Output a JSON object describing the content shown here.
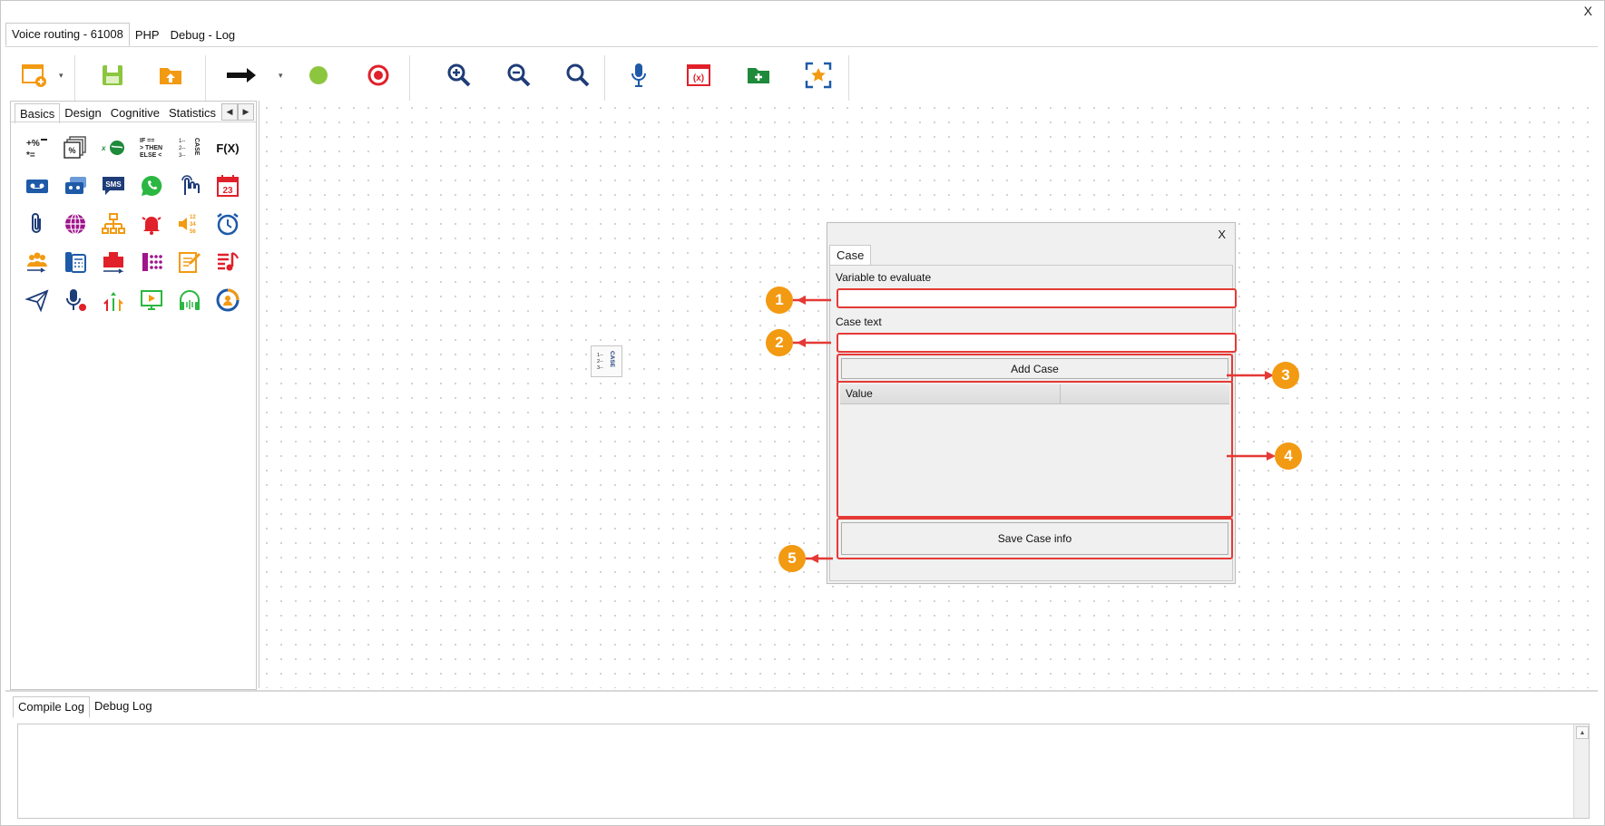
{
  "window": {
    "close_label": "X"
  },
  "top_tabs": [
    {
      "label": "Voice routing - 61008"
    },
    {
      "label": "PHP"
    },
    {
      "label": "Debug - Log"
    }
  ],
  "palette": {
    "tabs": [
      {
        "label": "Basics"
      },
      {
        "label": "Design"
      },
      {
        "label": "Cognitive"
      },
      {
        "label": "Statistics"
      }
    ]
  },
  "dialog": {
    "close_label": "X",
    "tab_label": "Case",
    "variable_label": "Variable to evaluate",
    "variable_value": "",
    "case_text_label": "Case text",
    "case_text_value": "",
    "add_case_label": "Add Case",
    "grid_columns": [
      "Value",
      ""
    ],
    "save_label": "Save Case info"
  },
  "callouts": [
    "1",
    "2",
    "3",
    "4",
    "5"
  ],
  "bottom_tabs": [
    {
      "label": "Compile Log"
    },
    {
      "label": "Debug Log"
    }
  ],
  "colors": {
    "accent_orange": "#f29a12",
    "highlight_red": "#e53935",
    "save_green": "#8cc63f",
    "stop_red": "#e0202a",
    "blue": "#1e5aa8"
  }
}
